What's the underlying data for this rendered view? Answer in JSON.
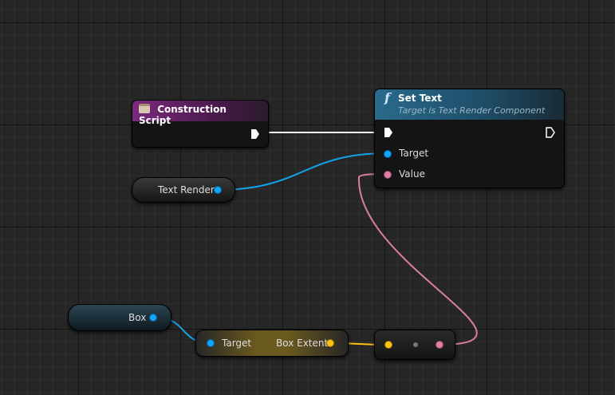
{
  "construction_script": {
    "title": "Construction Script"
  },
  "set_text": {
    "title": "Set Text",
    "subtitle": "Target is Text Render Component",
    "func_icon": "f",
    "target_label": "Target",
    "value_label": "Value"
  },
  "text_render_var": {
    "label": "Text Render"
  },
  "box_var": {
    "label": "Box"
  },
  "box_extent": {
    "target_label": "Target",
    "output_label": "Box Extent"
  },
  "colors": {
    "exec_wire": "#ffffff",
    "object_pin": "#0ea5ff",
    "text_pin": "#e57ca6",
    "vector_pin": "#ffc20e",
    "function_header": "#1e4f6a",
    "event_header": "#6b1f6e"
  }
}
